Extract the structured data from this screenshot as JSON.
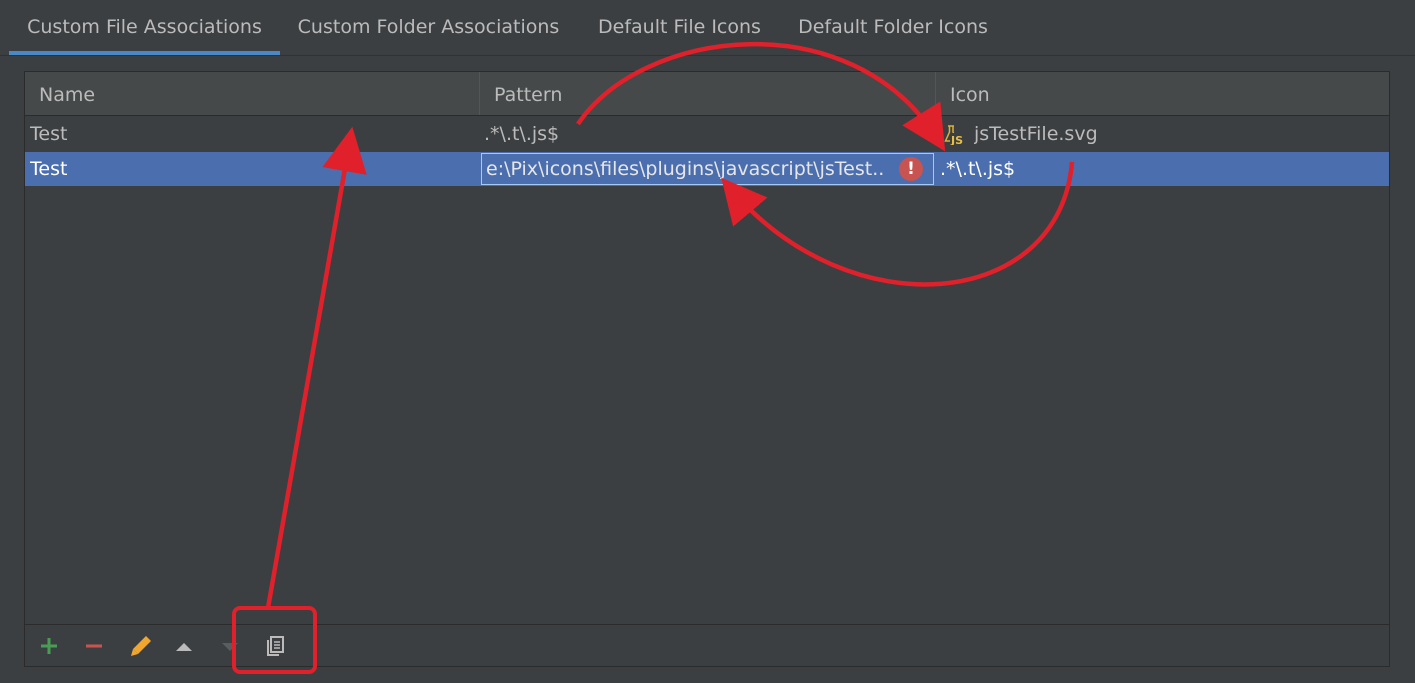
{
  "tabs": [
    {
      "label": "Custom File Associations",
      "active": true
    },
    {
      "label": "Custom Folder Associations",
      "active": false
    },
    {
      "label": "Default File Icons",
      "active": false
    },
    {
      "label": "Default Folder Icons",
      "active": false
    }
  ],
  "table": {
    "columns": [
      "Name",
      "Pattern",
      "Icon"
    ],
    "rows": [
      {
        "name": "Test",
        "pattern": ".*\\.t\\.js$",
        "icon_file": "jsTestFile.svg",
        "selected": false
      },
      {
        "name": "Test",
        "pattern": "e:\\Pix\\icons\\files\\plugins\\javascript\\jsTest...",
        "icon_value": ".*\\.t\\.js$",
        "selected": true,
        "editing": true,
        "error": true
      }
    ]
  },
  "toolbar": {
    "buttons": [
      "add-icon",
      "remove-icon",
      "edit-icon",
      "move-up-icon",
      "move-down-icon",
      "copy-icon"
    ]
  },
  "colors": {
    "background": "#3c3f41",
    "accent": "#4a88c7",
    "selection": "#4b6eaf",
    "annotation": "#e0202a",
    "error": "#c75450"
  },
  "icons": {
    "file_icon_badge": "JS",
    "error_glyph": "!"
  }
}
